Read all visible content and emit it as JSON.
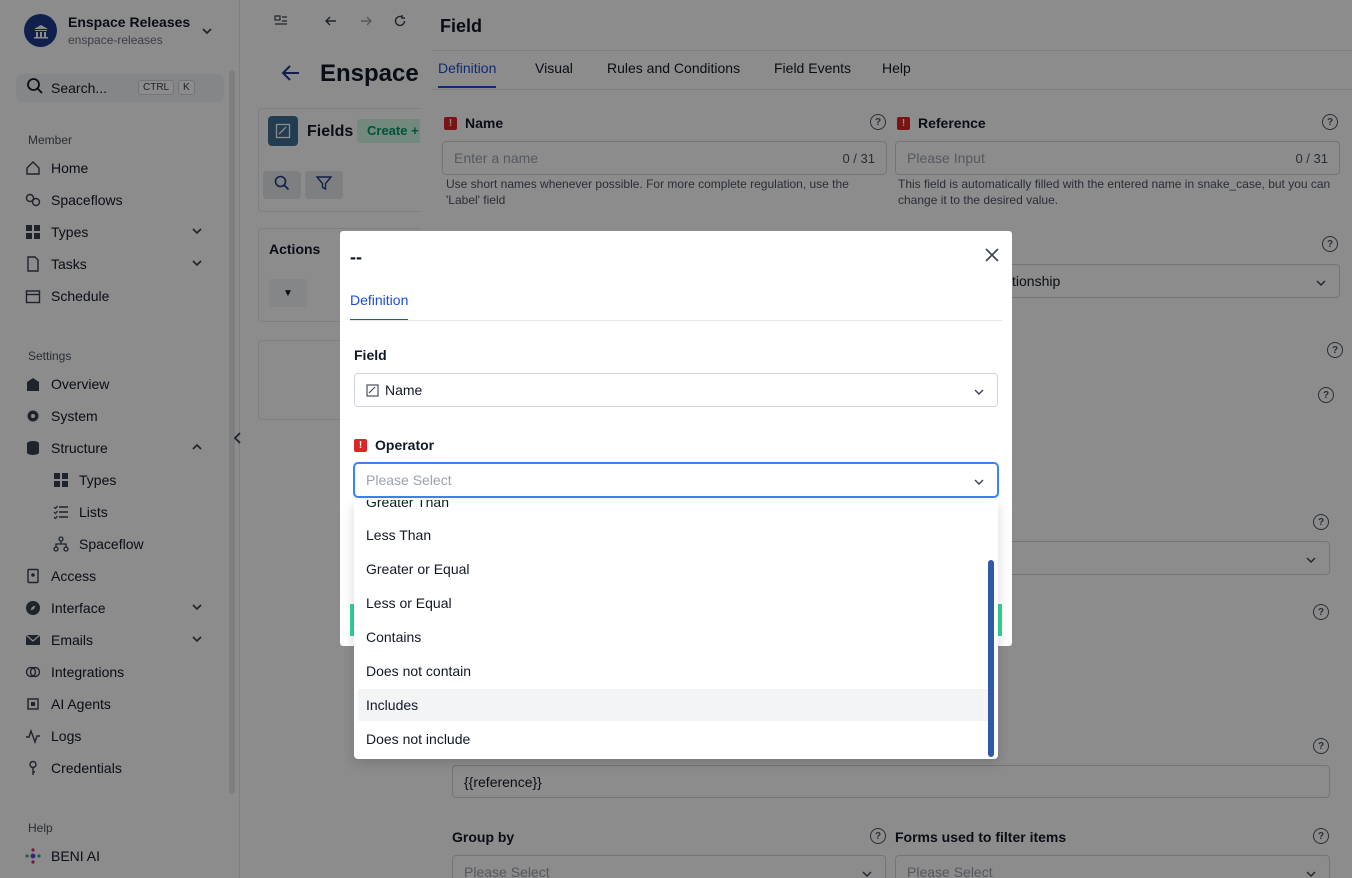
{
  "sidebar": {
    "brand_name": "Enspace Releases",
    "brand_slug": "enspace-releases",
    "search_label": "Search...",
    "kbd_ctrl": "CTRL",
    "kbd_k": "K",
    "member_label": "Member",
    "settings_label": "Settings",
    "help_label": "Help",
    "member_items": [
      {
        "label": "Home"
      },
      {
        "label": "Spaceflows"
      },
      {
        "label": "Types"
      },
      {
        "label": "Tasks"
      },
      {
        "label": "Schedule"
      }
    ],
    "settings_items": [
      {
        "label": "Overview"
      },
      {
        "label": "System"
      },
      {
        "label": "Structure"
      },
      {
        "label": "Types"
      },
      {
        "label": "Lists"
      },
      {
        "label": "Spaceflow"
      },
      {
        "label": "Access"
      },
      {
        "label": "Interface"
      },
      {
        "label": "Emails"
      },
      {
        "label": "Integrations"
      },
      {
        "label": "AI Agents"
      },
      {
        "label": "Logs"
      },
      {
        "label": "Credentials"
      }
    ],
    "help_items": [
      {
        "label": "BENI AI"
      }
    ]
  },
  "main": {
    "page_title": "Enspace I",
    "fields_title": "Fields",
    "create_label": "Create +",
    "actions_label": "Actions"
  },
  "drawer": {
    "title": "Field",
    "tabs": [
      {
        "label": "Definition"
      },
      {
        "label": "Visual"
      },
      {
        "label": "Rules and Conditions"
      },
      {
        "label": "Field Events"
      },
      {
        "label": "Help"
      }
    ],
    "name_label": "Name",
    "name_placeholder": "Enter a name",
    "name_counter": "0 / 31",
    "name_hint": "Use short names whenever possible. For more complete regulation, use the 'Label' field",
    "reference_label": "Reference",
    "reference_placeholder": "Please Input",
    "reference_counter": "0 / 31",
    "reference_hint": "This field is automatically filled with the entered name in snake_case, but you can change it to the desired value.",
    "type_value_partial": "tionship",
    "template_value": "{{reference}}",
    "group_by_label": "Group by",
    "group_by_placeholder": "Please Select",
    "forms_label": "Forms used to filter items",
    "forms_placeholder": "Please Select"
  },
  "modal": {
    "title": "--",
    "tab_label": "Definition",
    "field_label": "Field",
    "field_value": "Name",
    "operator_label": "Operator",
    "operator_placeholder": "Please Select"
  },
  "dropdown": {
    "options": [
      {
        "label": "Greater Than"
      },
      {
        "label": "Less Than"
      },
      {
        "label": "Greater or Equal"
      },
      {
        "label": "Less or Equal"
      },
      {
        "label": "Contains"
      },
      {
        "label": "Does not contain"
      },
      {
        "label": "Includes"
      },
      {
        "label": "Does not include"
      }
    ],
    "hovered": "Includes"
  },
  "colors": {
    "accent": "#1d4ed8",
    "brand": "#1e3a8a",
    "required": "#dc2626",
    "success": "#34d399"
  }
}
